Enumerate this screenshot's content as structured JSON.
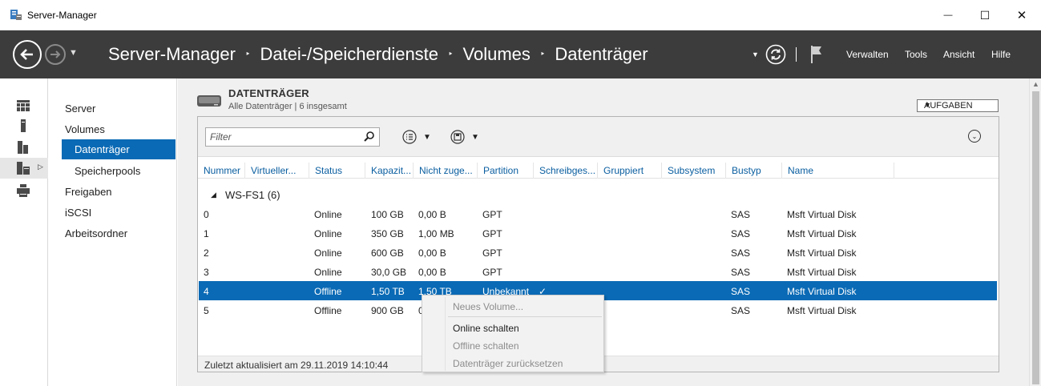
{
  "window": {
    "title": "Server-Manager",
    "controls": {
      "minimize": "—",
      "maximize": "☐",
      "close": "✕"
    }
  },
  "header": {
    "breadcrumb": [
      "Server-Manager",
      "Datei-/Speicherdienste",
      "Volumes",
      "Datenträger"
    ],
    "breadcrumb_separator": "‣",
    "menu": [
      "Verwalten",
      "Tools",
      "Ansicht",
      "Hilfe"
    ],
    "icons": [
      "back-icon",
      "forward-icon",
      "refresh-icon",
      "flag-icon"
    ]
  },
  "rail": {
    "icons": [
      "dashboard-icon",
      "local-server-icon",
      "all-servers-icon",
      "file-storage-icon",
      "print-services-icon"
    ]
  },
  "nav": {
    "items": [
      "Server",
      "Volumes",
      "Datenträger",
      "Speicherpools",
      "Freigaben",
      "iSCSI",
      "Arbeitsordner"
    ],
    "selected": "Datenträger"
  },
  "tile": {
    "title": "DATENTRÄGER",
    "subtitle": "Alle Datenträger | 6 insgesamt",
    "tasks_label": "AUFGABEN",
    "filter_placeholder": "Filter",
    "columns": [
      "Nummer",
      "Virtueller...",
      "Status",
      "Kapazit...",
      "Nicht zuge...",
      "Partition",
      "Schreibges...",
      "Gruppiert",
      "Subsystem",
      "Bustyp",
      "Name"
    ],
    "group_label": "WS-FS1 (6)",
    "rows": [
      {
        "nummer": "0",
        "virtuell": "",
        "status": "Online",
        "kapazitaet": "100 GB",
        "nicht_zugeordnet": "0,00 B",
        "partition": "GPT",
        "schreibgeschuetzt": "",
        "bustyp": "SAS",
        "name": "Msft Virtual Disk"
      },
      {
        "nummer": "1",
        "virtuell": "",
        "status": "Online",
        "kapazitaet": "350 GB",
        "nicht_zugeordnet": "1,00 MB",
        "partition": "GPT",
        "schreibgeschuetzt": "",
        "bustyp": "SAS",
        "name": "Msft Virtual Disk"
      },
      {
        "nummer": "2",
        "virtuell": "",
        "status": "Online",
        "kapazitaet": "600 GB",
        "nicht_zugeordnet": "0,00 B",
        "partition": "GPT",
        "schreibgeschuetzt": "",
        "bustyp": "SAS",
        "name": "Msft Virtual Disk"
      },
      {
        "nummer": "3",
        "virtuell": "",
        "status": "Online",
        "kapazitaet": "30,0 GB",
        "nicht_zugeordnet": "0,00 B",
        "partition": "GPT",
        "schreibgeschuetzt": "",
        "bustyp": "SAS",
        "name": "Msft Virtual Disk"
      },
      {
        "nummer": "4",
        "virtuell": "",
        "status": "Offline",
        "kapazitaet": "1,50 TB",
        "nicht_zugeordnet": "1,50 TB",
        "partition": "Unbekannt",
        "schreibgeschuetzt": "✓",
        "bustyp": "SAS",
        "name": "Msft Virtual Disk"
      },
      {
        "nummer": "5",
        "virtuell": "",
        "status": "Offline",
        "kapazitaet": "900 GB",
        "nicht_zugeordnet": "0",
        "partition": "",
        "schreibgeschuetzt": "",
        "bustyp": "SAS",
        "name": "Msft Virtual Disk"
      }
    ],
    "status_text": "Zuletzt aktualisiert am 29.11.2019 14:10:44"
  },
  "context_menu": {
    "items": [
      {
        "label": "Neues Volume...",
        "enabled": false
      },
      {
        "label": "Online schalten",
        "enabled": true
      },
      {
        "label": "Offline schalten",
        "enabled": false
      },
      {
        "label": "Datenträger zurücksetzen",
        "enabled": false
      }
    ]
  },
  "colors": {
    "header_bg": "#3c3c3c",
    "selection": "#0a6ab5",
    "column_header_text": "#0a5ea0",
    "main_bg": "#f0f0f0"
  }
}
